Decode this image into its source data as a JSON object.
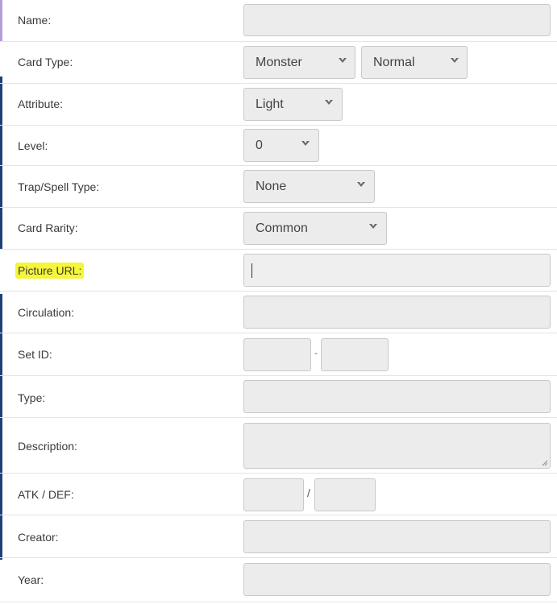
{
  "form": {
    "name": {
      "label": "Name:",
      "value": ""
    },
    "card_type": {
      "label": "Card Type:",
      "primary": "Monster",
      "secondary": "Normal"
    },
    "attribute": {
      "label": "Attribute:",
      "value": "Light"
    },
    "level": {
      "label": "Level:",
      "value": "0"
    },
    "trap_spell_type": {
      "label": "Trap/Spell Type:",
      "value": "None"
    },
    "card_rarity": {
      "label": "Card Rarity:",
      "value": "Common"
    },
    "picture_url": {
      "label": "Picture URL:",
      "value": "",
      "highlight_color": "#f5f53b"
    },
    "circulation": {
      "label": "Circulation:",
      "value": ""
    },
    "set_id": {
      "label": "Set ID:",
      "separator": "-",
      "part1": "",
      "part2": ""
    },
    "type": {
      "label": "Type:",
      "value": ""
    },
    "description": {
      "label": "Description:",
      "value": ""
    },
    "atk_def": {
      "label": "ATK / DEF:",
      "separator": "/",
      "atk": "",
      "def": ""
    },
    "creator": {
      "label": "Creator:",
      "value": ""
    },
    "year": {
      "label": "Year:",
      "value": ""
    }
  },
  "icons": {
    "dropdown": "chevron-down-icon",
    "resize": "resize-handle-icon"
  },
  "colors": {
    "input_bg": "#ececec",
    "input_border": "#c8c8c8",
    "accent_bar": "#1f3f7a",
    "top_bar": "#b39ddb"
  }
}
